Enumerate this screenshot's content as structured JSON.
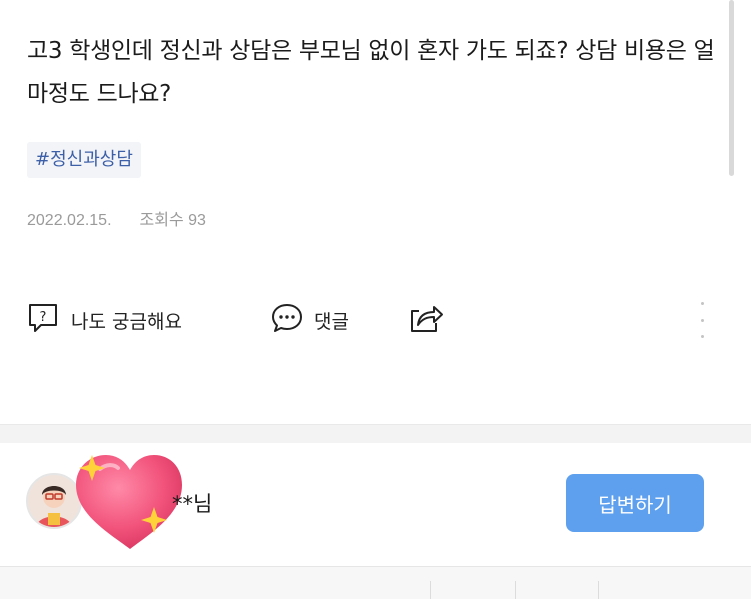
{
  "question": {
    "text": "고3 학생인데 정신과 상담은 부모님 없이 혼자 가도 되죠? 상담 비용은 얼마정도 드나요?",
    "hashtag": "#정신과상담",
    "date": "2022.02.15.",
    "views_label": "조회수 93"
  },
  "actions": {
    "curious_label": "나도 궁금해요",
    "comment_label": "댓글"
  },
  "answer": {
    "nickname": "**님",
    "answer_button_label": "답변하기"
  },
  "colors": {
    "accent": "#5ea0ee",
    "hashtag": "#3d5fa8",
    "meta": "#9a9a9a"
  },
  "icons": {
    "curious": "question-box-icon",
    "comment": "speech-bubble-icon",
    "share": "share-icon",
    "more": "more-vertical-icon",
    "sticker": "sparkle-heart-icon"
  }
}
